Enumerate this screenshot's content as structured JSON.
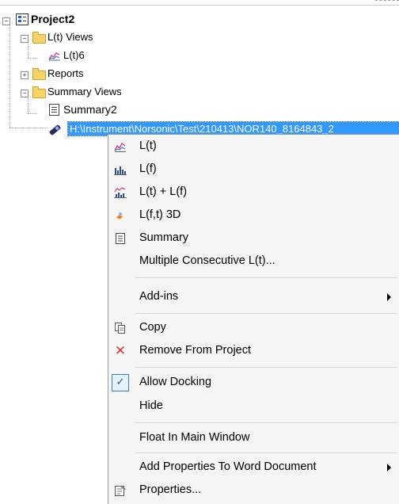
{
  "tree": {
    "project": {
      "label": "Project2",
      "expanded": true
    },
    "lt_views": {
      "label": "L(t) Views",
      "expanded": true,
      "children": [
        {
          "label": "L(t)6",
          "icon": "line-chart-icon"
        }
      ]
    },
    "reports": {
      "label": "Reports",
      "expanded": false
    },
    "summary_views": {
      "label": "Summary Views",
      "expanded": true,
      "children": [
        {
          "label": "Summary2",
          "icon": "summary-doc-icon"
        }
      ]
    },
    "measurement_file": {
      "label": "H:\\Instrument\\Norsonic\\Test\\210413\\NOR140_8164843_2",
      "icon": "instrument-icon",
      "selected": true
    }
  },
  "context_menu": {
    "items": [
      {
        "label": "L(t)",
        "icon": "line-chart-icon"
      },
      {
        "label": "L(f)",
        "icon": "bar-chart-icon"
      },
      {
        "label": "L(t) + L(f)",
        "icon": "combined-chart-icon"
      },
      {
        "label": "L(f,t) 3D",
        "icon": "3d-chart-icon"
      },
      {
        "label": "Summary",
        "icon": "summary-doc-icon"
      },
      {
        "label": "Multiple Consecutive L(t)...",
        "icon": ""
      },
      {
        "label": "Add-ins",
        "icon": "",
        "submenu": true
      },
      {
        "label": "Copy",
        "icon": "copy-icon"
      },
      {
        "label": "Remove From Project",
        "icon": "remove-x-icon"
      },
      {
        "label": "Allow Docking",
        "icon": "checkmark-icon",
        "checked": true
      },
      {
        "label": "Hide",
        "icon": ""
      },
      {
        "label": "Float In Main Window",
        "icon": ""
      },
      {
        "label": "Add Properties To Word Document",
        "icon": "",
        "submenu": true
      },
      {
        "label": "Properties...",
        "icon": "properties-icon"
      }
    ]
  },
  "colors": {
    "selection": "#3399ff",
    "menu_background": "#f5f5f5",
    "folder": "#f6d365",
    "remove_icon": "#d43a3a"
  }
}
